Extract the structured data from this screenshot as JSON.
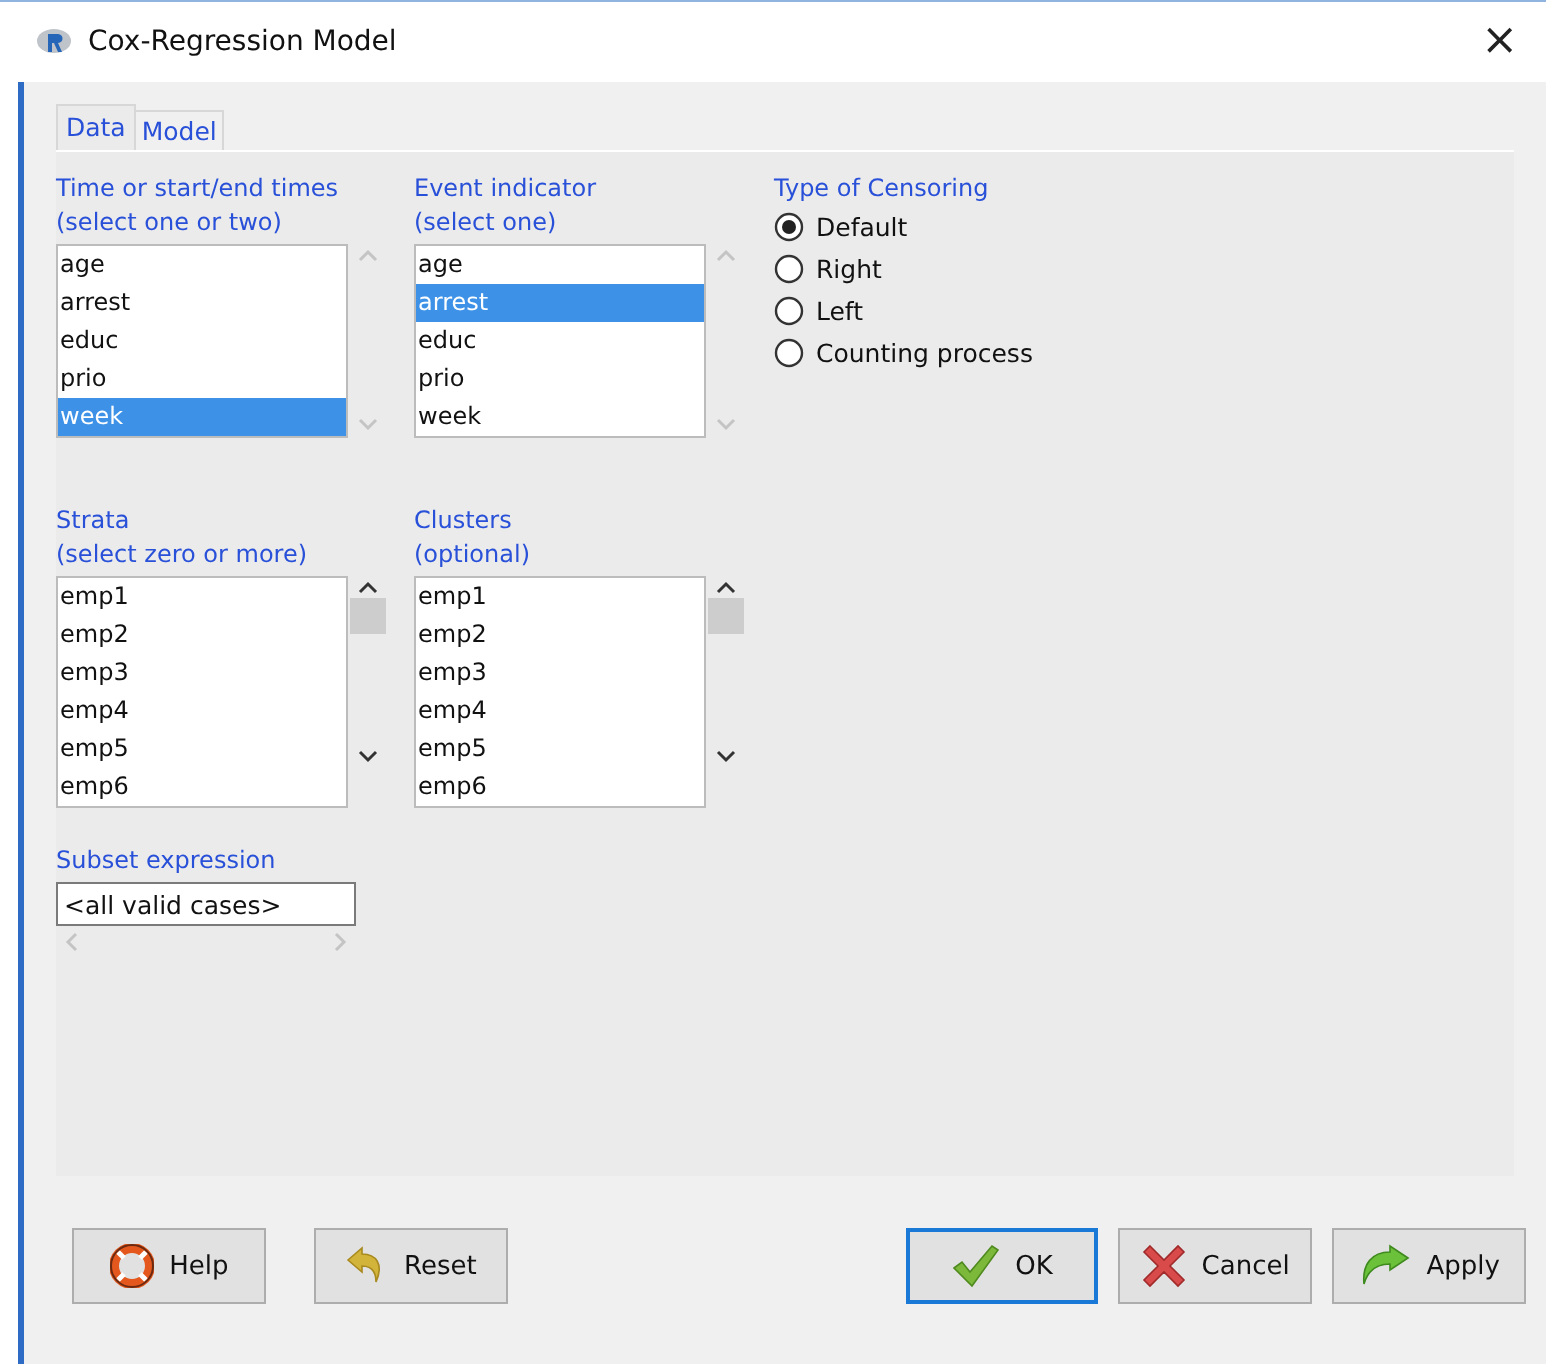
{
  "window": {
    "title": "Cox-Regression Model",
    "close": "×"
  },
  "tabs": [
    {
      "label": "Data",
      "selected": true
    },
    {
      "label": "Model",
      "selected": false
    }
  ],
  "lists": [
    {
      "label": "Time or start/end times\n(select one or two)",
      "scroll_enabled": false,
      "items": [
        {
          "text": "age",
          "selected": false
        },
        {
          "text": "arrest",
          "selected": false
        },
        {
          "text": "educ",
          "selected": false
        },
        {
          "text": "prio",
          "selected": false
        },
        {
          "text": "week",
          "selected": true
        }
      ]
    },
    {
      "label": "Event indicator\n(select one)",
      "scroll_enabled": false,
      "items": [
        {
          "text": "age",
          "selected": false
        },
        {
          "text": "arrest",
          "selected": true
        },
        {
          "text": "educ",
          "selected": false
        },
        {
          "text": "prio",
          "selected": false
        },
        {
          "text": "week",
          "selected": false
        }
      ]
    },
    {
      "label": "Strata\n(select zero or more)",
      "scroll_enabled": true,
      "items": [
        {
          "text": "emp1",
          "selected": false
        },
        {
          "text": "emp2",
          "selected": false
        },
        {
          "text": "emp3",
          "selected": false
        },
        {
          "text": "emp4",
          "selected": false
        },
        {
          "text": "emp5",
          "selected": false
        },
        {
          "text": "emp6",
          "selected": false
        }
      ]
    },
    {
      "label": "Clusters\n(optional)",
      "scroll_enabled": true,
      "items": [
        {
          "text": "emp1",
          "selected": false
        },
        {
          "text": "emp2",
          "selected": false
        },
        {
          "text": "emp3",
          "selected": false
        },
        {
          "text": "emp4",
          "selected": false
        },
        {
          "text": "emp5",
          "selected": false
        },
        {
          "text": "emp6",
          "selected": false
        }
      ]
    }
  ],
  "censoring": {
    "label": "Type of Censoring",
    "options": [
      {
        "label": "Default",
        "selected": true
      },
      {
        "label": "Right",
        "selected": false
      },
      {
        "label": "Left",
        "selected": false
      },
      {
        "label": "Counting process",
        "selected": false
      }
    ]
  },
  "subset": {
    "label": "Subset expression",
    "value": "<all valid cases>"
  },
  "buttons": [
    {
      "kind": "help",
      "label": "Help",
      "default": false
    },
    {
      "kind": "reset",
      "label": "Reset",
      "default": false
    },
    {
      "kind": "ok",
      "label": "OK",
      "default": true
    },
    {
      "kind": "cancel",
      "label": "Cancel",
      "default": false
    },
    {
      "kind": "apply",
      "label": "Apply",
      "default": false
    }
  ]
}
